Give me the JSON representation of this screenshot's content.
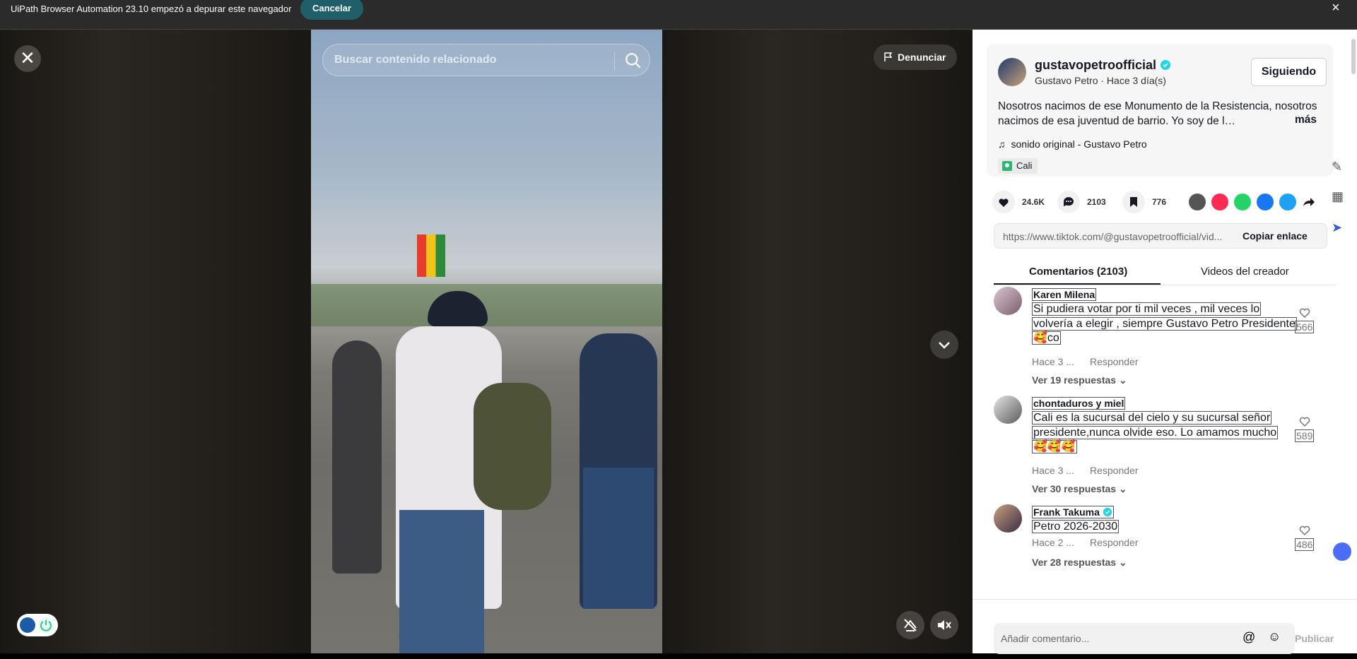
{
  "infobar": {
    "message": "UiPath Browser Automation 23.10 empezó a depurar este navegador",
    "cancel": "Cancelar",
    "close": "×"
  },
  "video": {
    "close": "✕",
    "search_placeholder": "Buscar contenido relacionado",
    "report": "Denunciar"
  },
  "post": {
    "username": "gustavopetroofficial",
    "subtitle": "Gustavo Petro · Hace 3 día(s)",
    "follow": "Siguiendo",
    "description": "Nosotros nacimos de ese Monumento de la Resistencia, nosotros nacimos de esa juventud de barrio. Yo soy de l…",
    "more": "más",
    "music": "sonido original - Gustavo Petro",
    "location": "Cali",
    "likes": "24.6K",
    "comments": "2103",
    "saves": "776",
    "link": "https://www.tiktok.com/@gustavopetroofficial/vid...",
    "copy": "Copiar enlace"
  },
  "tabs": {
    "comments": "Comentarios (2103)",
    "creator": "Videos del creador"
  },
  "comment_list": [
    {
      "name": "Karen Milena",
      "lines": [
        "Si pudiera votar por ti mil veces , mil veces lo",
        "volvería a elegir , siempre Gustavo Petro Presidente",
        "🥰co"
      ],
      "time": "Hace 3 ...",
      "reply": "Responder",
      "likes": "566",
      "replies": "Ver 19 respuestas"
    },
    {
      "name": "chontaduros y miel",
      "lines": [
        "Cali es la sucursal del cielo y su sucursal señor",
        "presidente,nunca olvide eso. Lo amamos mucho",
        "🥰🥰🥰"
      ],
      "time": "Hace 3 ...",
      "reply": "Responder",
      "likes": "589",
      "replies": "Ver 30 respuestas"
    },
    {
      "name": "Frank Takuma",
      "lines": [
        "Petro 2026-2030"
      ],
      "time": "Hace 2 ...",
      "reply": "Responder",
      "likes": "486",
      "replies": "Ver 28 respuestas"
    }
  ],
  "composer": {
    "placeholder": "Añadir comentario...",
    "publish": "Publicar"
  }
}
